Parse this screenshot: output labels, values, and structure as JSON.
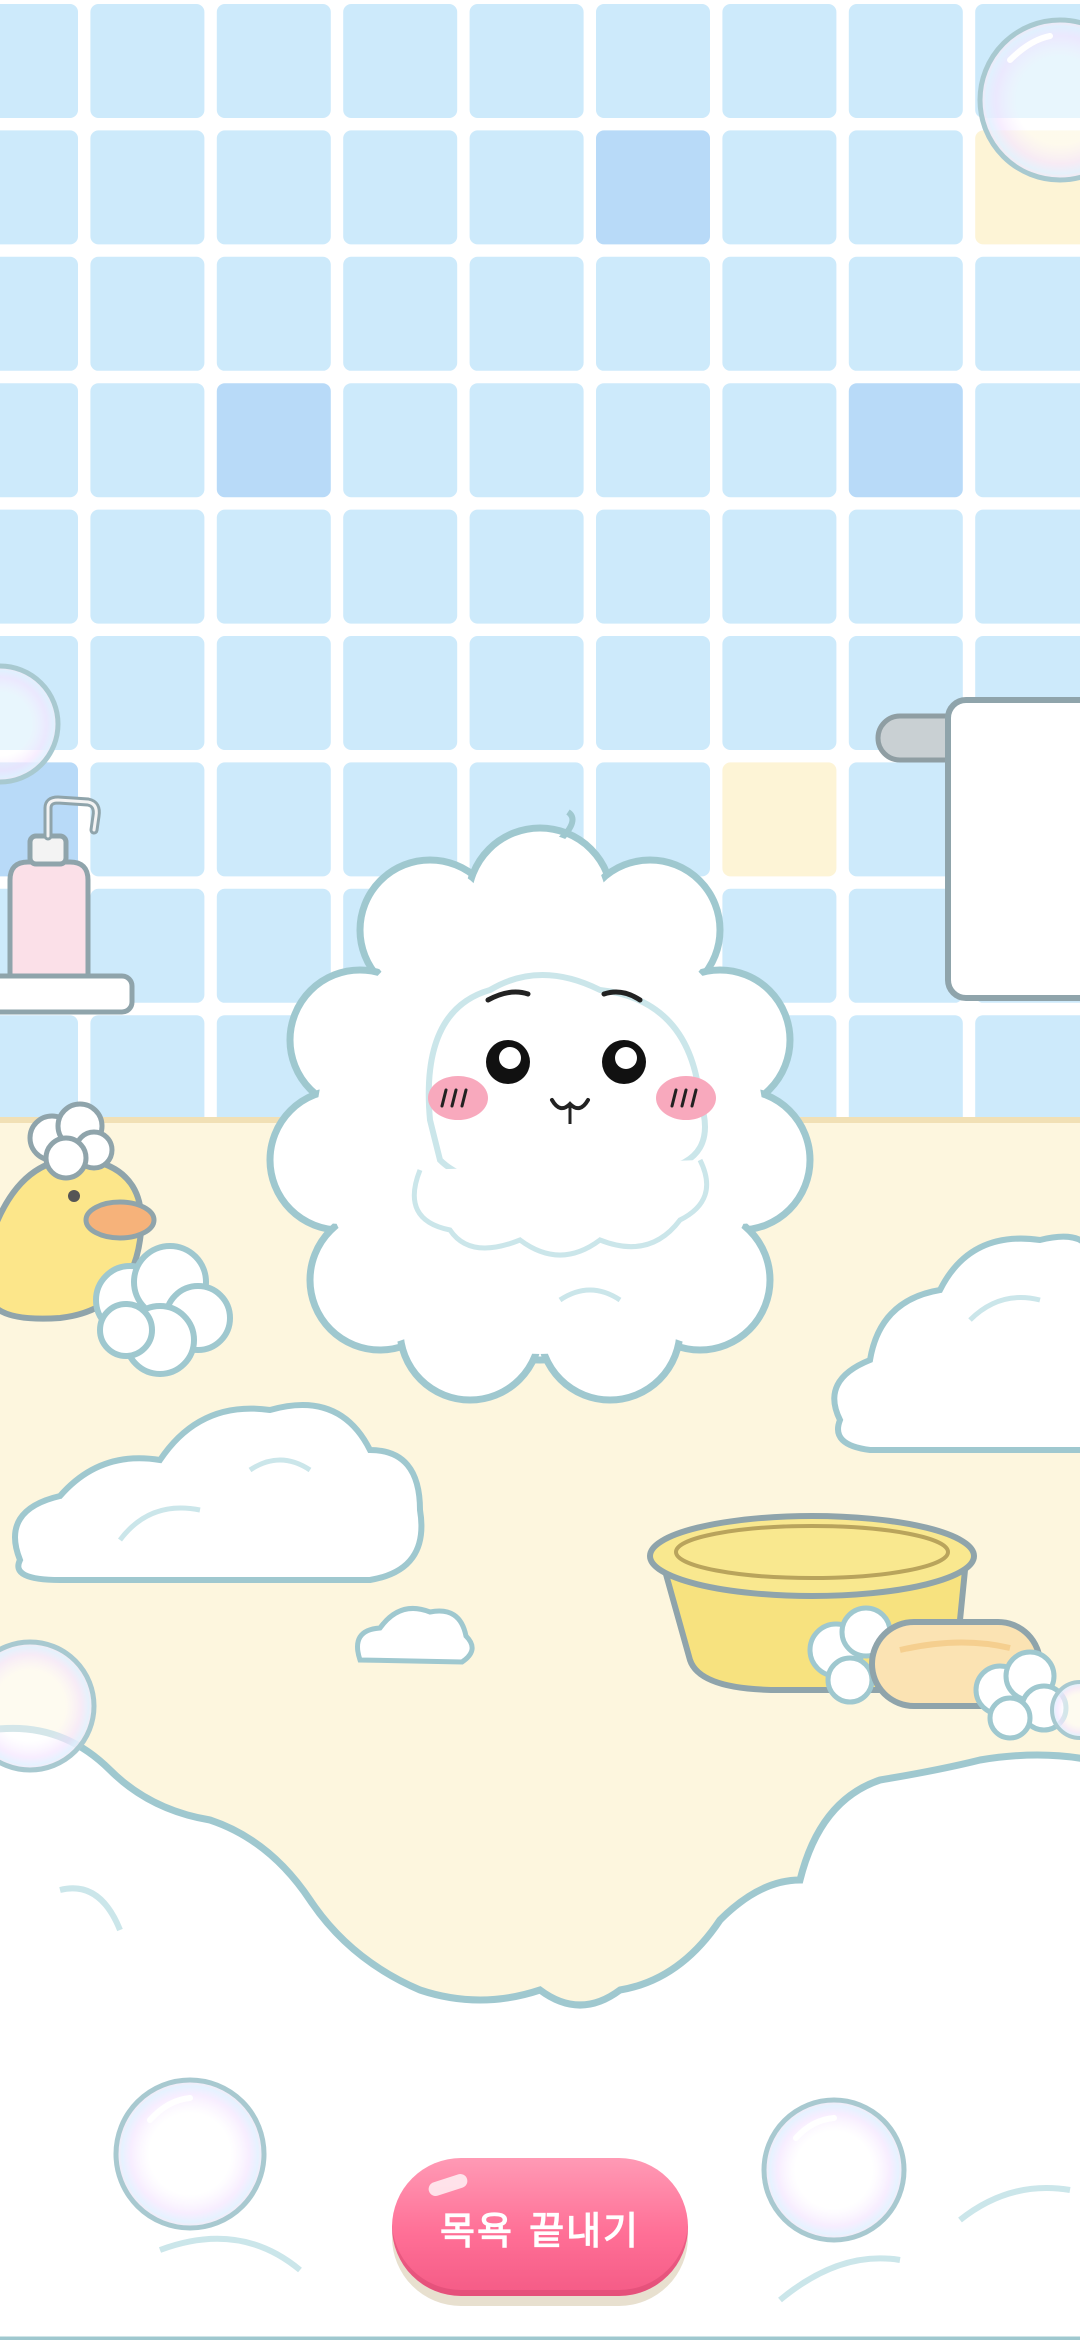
{
  "scene": {
    "name": "bath-time",
    "colors": {
      "tile": "#cdeafb",
      "grout": "#ffffff",
      "tile_accent": "#b8daf8",
      "tile_yellow": "#fdf4d6",
      "floor": "#fdf6de",
      "outline": "#9fc8cf",
      "foam": "#ffffff",
      "duck": "#fce68a",
      "tub": "#f7e27f",
      "soap": "#fbe3b3",
      "soap_bottle": "#fbe0e8",
      "cheek": "#f8a9bd"
    },
    "icons": [
      "soap-dispenser-icon",
      "rubber-duck-icon",
      "towel-icon",
      "washbasin-icon",
      "soap-bar-icon",
      "bubble-icon"
    ]
  },
  "finish_button": {
    "label": "목욕 끝내기",
    "color": "#ff7096"
  }
}
